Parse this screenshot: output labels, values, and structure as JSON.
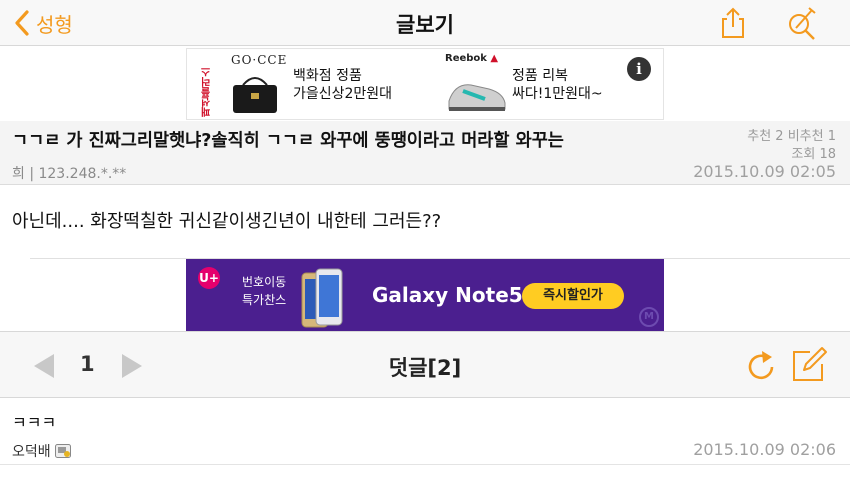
{
  "navbar": {
    "back_label": "성형",
    "title": "글보기"
  },
  "ad_top": {
    "brand_left": "GO·CCE",
    "text_left_line1": "백화점 정품",
    "text_left_line2": "가을신상2만원대",
    "brand_right": "Reebok",
    "text_right_line1": "정품 리복",
    "text_right_line2": "싸다!1만원대~",
    "vertical_mark": "패션플러스",
    "info_label": "i"
  },
  "post": {
    "title": "ㄱㄱㄹ 가 진짜그리말햇냐?솔직히 ㄱㄱㄹ 와꾸에 뚱땡이라고 머라할 와꾸는",
    "stats_line1": "추천 2 비추천 1",
    "stats_line2": "조회 18",
    "author": "희 | 123.248.*.**",
    "date": "2015.10.09 02:05",
    "body": "아닌데.... 화장떡칠한 귀신같이생긴년이 내한테 그러든??"
  },
  "ad_mid": {
    "logo": "U+",
    "text_line1": "번호이동",
    "text_line2": "특가찬스",
    "title": "Galaxy Note5",
    "cta": "즉시할인가",
    "mark": "M"
  },
  "comments_bar": {
    "page": "1",
    "title": "덧글[2]"
  },
  "comments": [
    {
      "text": "ㅋㅋㅋ",
      "author": "오덕배",
      "date": "2015.10.09 02:06"
    }
  ],
  "colors": {
    "accent": "#f39a1f",
    "ad_purple": "#4b1f8f"
  }
}
